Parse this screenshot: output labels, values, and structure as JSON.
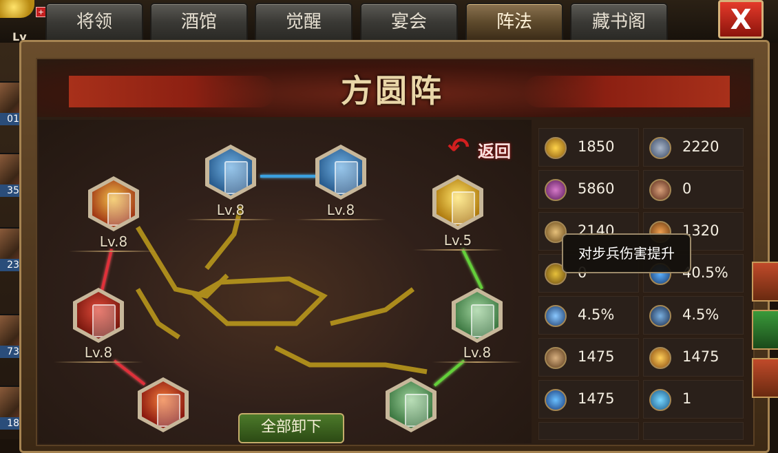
{
  "header": {
    "tabs": [
      {
        "label": "将领",
        "active": false
      },
      {
        "label": "酒馆",
        "active": false
      },
      {
        "label": "觉醒",
        "active": false
      },
      {
        "label": "宴会",
        "active": false
      },
      {
        "label": "阵法",
        "active": true
      },
      {
        "label": "藏书阁",
        "active": false
      }
    ],
    "close_label": "X",
    "player_level_label": "Lv"
  },
  "left_roster": [
    "01",
    "35",
    "23",
    "73",
    "18"
  ],
  "formation": {
    "title": "方圆阵",
    "return_label": "返回",
    "unequip_all_label": "全部卸下",
    "slots": [
      {
        "level": "Lv.8",
        "color": "blue"
      },
      {
        "level": "Lv.8",
        "color": "blue"
      },
      {
        "level": "Lv.8",
        "color": "gold"
      },
      {
        "level": "Lv.5",
        "color": "gold"
      },
      {
        "level": "Lv.8",
        "color": "red"
      },
      {
        "level": "Lv.8",
        "color": "green"
      },
      {
        "level": "",
        "color": "red"
      },
      {
        "level": "",
        "color": "green"
      }
    ],
    "link_colors": {
      "blue": "#3aa0e0",
      "red": "#e0303a",
      "green": "#63d03a"
    }
  },
  "stats": [
    {
      "icon": "attack-icon",
      "value": "1850"
    },
    {
      "icon": "defense-shield-icon",
      "value": "2220"
    },
    {
      "icon": "strategy-icon",
      "value": "5860"
    },
    {
      "icon": "counter-icon",
      "value": "0"
    },
    {
      "icon": "infantry-attack-icon",
      "value": "2140"
    },
    {
      "icon": "infantry-defense-icon",
      "value": "1320"
    },
    {
      "icon": "cavalry-icon",
      "value": "0"
    },
    {
      "icon": "crit-icon",
      "value": "40.5%"
    },
    {
      "icon": "archer-icon",
      "value": "4.5%"
    },
    {
      "icon": "pierce-icon",
      "value": "4.5%"
    },
    {
      "icon": "beast-icon",
      "value": "1475"
    },
    {
      "icon": "burst-icon",
      "value": "1475"
    },
    {
      "icon": "wind-icon",
      "value": "1475"
    },
    {
      "icon": "gem-icon",
      "value": "1"
    },
    {
      "icon": "",
      "value": ""
    },
    {
      "icon": "",
      "value": ""
    }
  ],
  "tooltip": "对步兵伤害提升"
}
